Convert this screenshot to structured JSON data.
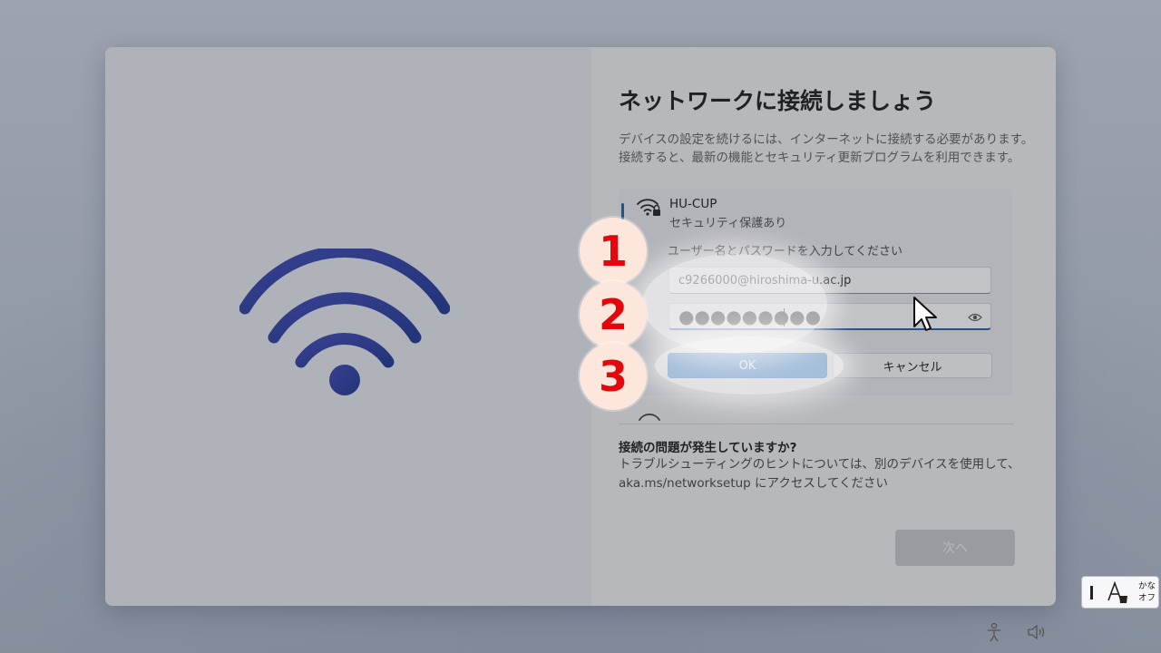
{
  "page": {
    "title": "ネットワークに接続しましょう",
    "description": "デバイスの設定を続けるには、インターネットに接続する必要があります。接続すると、最新の機能とセキュリティ更新プログラムを利用できます。"
  },
  "network": {
    "name": "HU-CUP",
    "security": "セキュリティ保護あり",
    "credentials_label": "ユーザー名とパスワードを入力してください",
    "username_value": "c9266000@hiroshima-u.ac.jp",
    "password_value": "●●●●●●●●●",
    "ok_label": "OK",
    "cancel_label": "キャンセル"
  },
  "help": {
    "title": "接続の問題が発生していますか?",
    "body": "トラブルシューティングのヒントについては、別のデバイスを使用して、aka.ms/networksetup にアクセスしてください"
  },
  "next_button": "次へ",
  "annotations": {
    "step1": "1",
    "step2": "2",
    "step3": "3"
  },
  "ime": {
    "kana_line1": "かな",
    "kana_line2": "オフ"
  },
  "colors": {
    "accent": "#0a63c2",
    "step_number": "#e3060c",
    "step_badge": "#fde7dc",
    "wifi_hero": "#2b3f9e"
  },
  "icons": {
    "hero": "wifi-icon",
    "network": "wifi-lock-icon",
    "reveal": "eye-icon",
    "tray_access": "accessibility-icon",
    "tray_volume": "volume-icon"
  }
}
